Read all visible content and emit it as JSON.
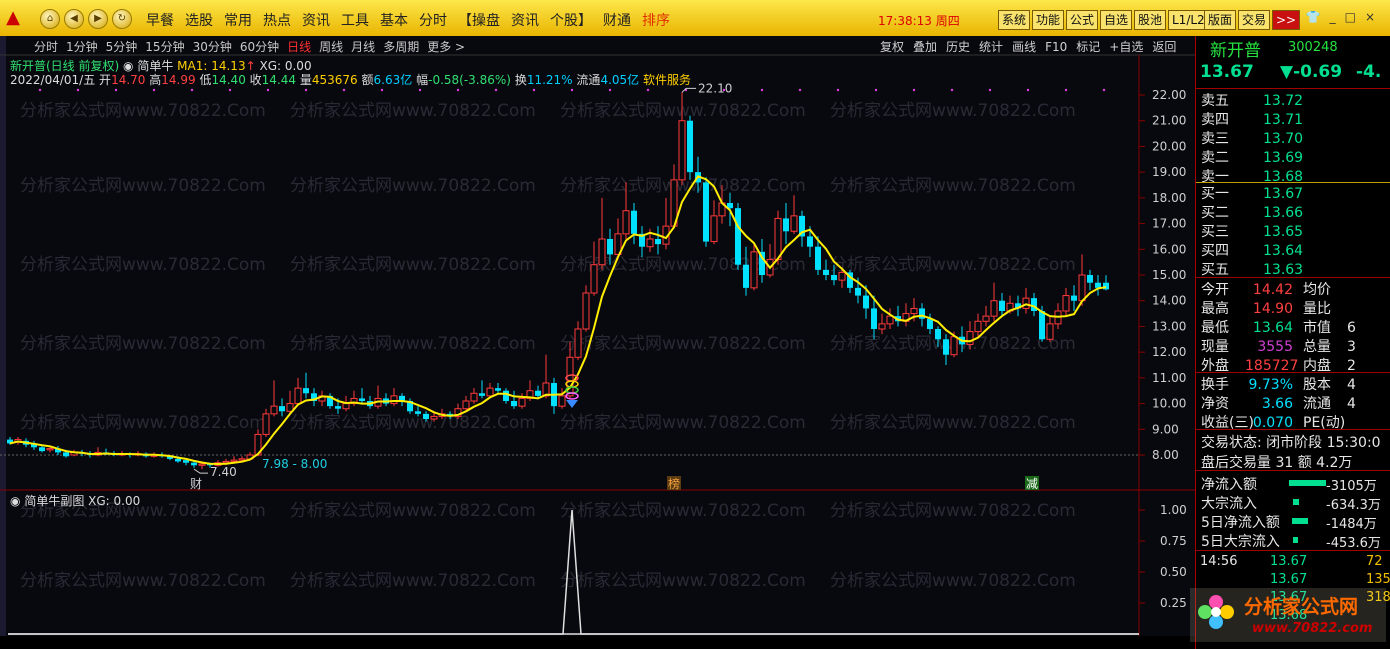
{
  "menubar": {
    "logo": "▲",
    "nav_icons": [
      "home-icon",
      "back-icon",
      "forward-icon",
      "refresh-icon"
    ],
    "items": [
      "早餐",
      "选股",
      "常用",
      "热点",
      "资讯",
      "工具",
      "基本",
      "分时",
      "【操盘",
      "资讯",
      "个股】",
      "财通",
      "排序"
    ],
    "clock": "17:38:13",
    "weekday": "周四",
    "right_buttons": [
      "系统",
      "功能",
      "公式",
      "自选",
      "股池",
      "L1/L2",
      "版面",
      "交易",
      ">>"
    ]
  },
  "chart_toolbar": {
    "periods": [
      "分时",
      "1分钟",
      "5分钟",
      "15分钟",
      "30分钟",
      "60分钟",
      "日线",
      "周线",
      "月线",
      "多周期",
      "更多 >"
    ],
    "active_period": "日线",
    "tools": [
      "复权",
      "叠加",
      "历史",
      "统计",
      "画线",
      "F10",
      "标记",
      "+自选",
      "返回"
    ]
  },
  "chart_header": {
    "title": "新开普(日线 前复权)",
    "indicator_name": "简单牛",
    "ma_label": "MA1: 14.13",
    "ma_arrow": "↑",
    "xg_label": "XG: 0.00",
    "date": "2022/04/01/五",
    "open_label": "开",
    "open": "14.70",
    "high_label": "高",
    "high": "14.99",
    "low_label": "低",
    "low": "14.40",
    "close_label": "收",
    "close": "14.44",
    "volume_label": "量",
    "volume": "453676",
    "amount_label": "额",
    "amount": "6.63亿",
    "change_label": "幅",
    "change": "-0.58(-3.86%)",
    "turnover_label": "换",
    "turnover": "11.21%",
    "float_label": "流通",
    "float": "4.05亿",
    "sector": "软件服务"
  },
  "price_axis": [
    "22.00",
    "21.00",
    "20.00",
    "19.00",
    "18.00",
    "17.00",
    "16.00",
    "15.00",
    "14.00",
    "13.00",
    "12.00",
    "11.00",
    "10.00",
    "9.00",
    "8.00"
  ],
  "chart_annotations": {
    "high_mark": "22.10",
    "low_mark": "7.40",
    "range_label": "7.98 - 8.00",
    "event_markers": [
      "财",
      "榜",
      "减"
    ]
  },
  "sub_chart": {
    "title": "简单牛副图",
    "xg_label": "XG: 0.00",
    "axis": [
      "1.00",
      "0.75",
      "0.50",
      "0.25"
    ]
  },
  "right_panel": {
    "name": "新开普",
    "code": "300248",
    "price": "13.67",
    "change": "▼-0.69",
    "change_pct": "-4.",
    "asks": [
      {
        "label": "卖五",
        "price": "13.72"
      },
      {
        "label": "卖四",
        "price": "13.71"
      },
      {
        "label": "卖三",
        "price": "13.70"
      },
      {
        "label": "卖二",
        "price": "13.69"
      },
      {
        "label": "卖一",
        "price": "13.68"
      }
    ],
    "bids": [
      {
        "label": "买一",
        "price": "13.67"
      },
      {
        "label": "买二",
        "price": "13.66"
      },
      {
        "label": "买三",
        "price": "13.65"
      },
      {
        "label": "买四",
        "price": "13.64"
      },
      {
        "label": "买五",
        "price": "13.63"
      }
    ],
    "stats": [
      {
        "l1": "今开",
        "v1": "14.42",
        "c1": "#ff4040",
        "l2": "均价"
      },
      {
        "l1": "最高",
        "v1": "14.90",
        "c1": "#ff4040",
        "l2": "量比"
      },
      {
        "l1": "最低",
        "v1": "13.64",
        "c1": "#00e090",
        "l2": "市值",
        "v2": "6"
      },
      {
        "l1": "现量",
        "v1": "3555",
        "c1": "#d040d0",
        "l2": "总量",
        "v2": "3"
      },
      {
        "l1": "外盘",
        "v1": "185727",
        "c1": "#ff4040",
        "l2": "内盘",
        "v2": "2"
      }
    ],
    "stats2": [
      {
        "l1": "换手",
        "v1": "9.73%",
        "c1": "#00e0ff",
        "l2": "股本",
        "v2": "4"
      },
      {
        "l1": "净资",
        "v1": "3.66",
        "c1": "#00e0ff",
        "l2": "流通",
        "v2": "4"
      },
      {
        "l1": "收益(三)",
        "v1": "0.070",
        "c1": "#00e0ff",
        "l2": "PE(动)"
      }
    ],
    "trade_status": "交易状态: 闭市阶段 15:30:0",
    "after_hours": "盘后交易量 31 额 4.2万",
    "money_flow": [
      {
        "label": "净流入额",
        "value": "-3105万",
        "bar": 0.9
      },
      {
        "label": "大宗流入",
        "value": "-634.3万",
        "bar": 0.15
      },
      {
        "label": "5日净流入额",
        "value": "-1484万",
        "bar": 0.4
      },
      {
        "label": "5日大宗流入",
        "value": "-453.6万",
        "bar": 0.12
      }
    ],
    "ticks": [
      {
        "time": "14:56",
        "price": "13.67",
        "vol": "72"
      },
      {
        "time": "",
        "price": "13.67",
        "vol": "135"
      },
      {
        "time": "",
        "price": "13.67",
        "vol": "318"
      },
      {
        "time": "",
        "price": "13.68",
        "vol": ""
      }
    ]
  },
  "watermark": {
    "text": "分析家公式网",
    "url": "www.70822.com",
    "bg_text": "分析家公式网www.70822.Com"
  }
}
